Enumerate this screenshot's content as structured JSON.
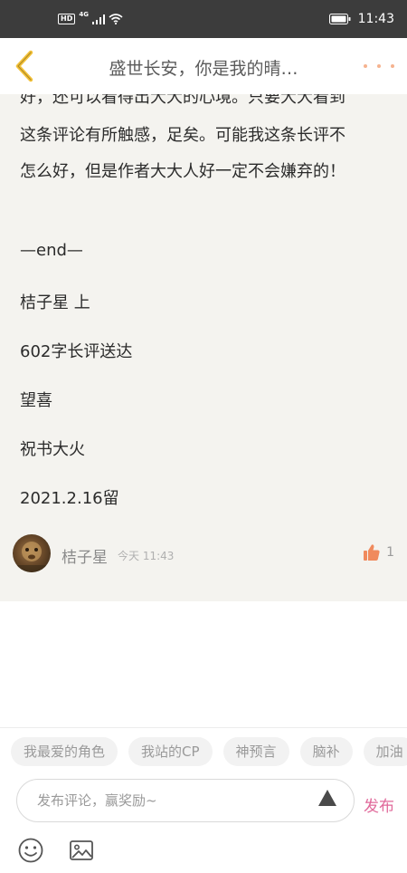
{
  "status_bar": {
    "hd": "HD",
    "network": "4G",
    "time": "11:43"
  },
  "header": {
    "title": "盛世长安，你是我的晴…",
    "back_icon": "chevron-left-icon",
    "more_icon": "more-dots-icon",
    "accent_color": "#f6b38f"
  },
  "comment": {
    "lines": [
      "好，还可以看得出大大的心境。只要大大看到",
      "这条评论有所触感，足矣。可能我这条长评不",
      "怎么好，但是作者大大人好一定不会嫌弃的！",
      "—end—",
      "桔子星 上",
      "602字长评送达",
      "望喜",
      "祝书大火",
      "2021.2.16留"
    ],
    "author": "桔子星",
    "time": "今天 11:43",
    "likes": "1",
    "like_color": "#f08a5d"
  },
  "composer": {
    "tags": [
      "我最爱的角色",
      "我站的CP",
      "神预言",
      "脑补",
      "加油"
    ],
    "placeholder": "发布评论，赢奖励~",
    "publish_label": "发布",
    "publish_color": "#e0699a",
    "icons": [
      "emoji-icon",
      "image-icon",
      "expand-up-icon"
    ]
  }
}
